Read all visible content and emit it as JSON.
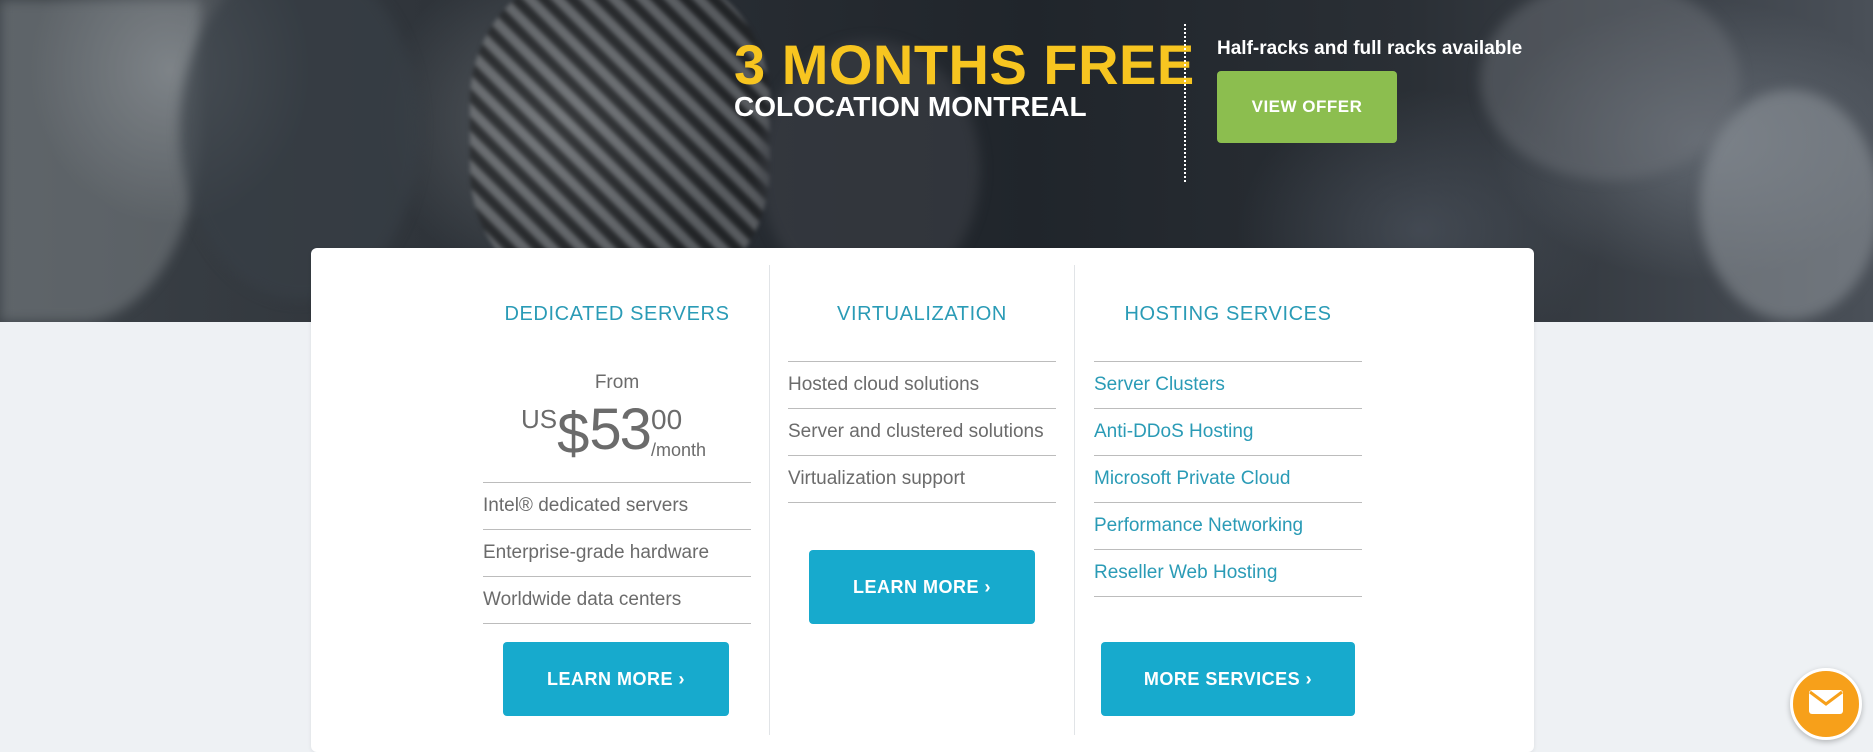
{
  "promo": {
    "headline": "3 MONTHS FREE",
    "subheadline": "COLOCATION MONTREAL",
    "offer_text": "Half-racks and full racks available",
    "offer_button": "VIEW OFFER"
  },
  "columns": {
    "dedicated": {
      "title": "DEDICATED SERVERS",
      "price_from": "From",
      "price_currency": "US",
      "price_symbol": "$",
      "price_amount": "53",
      "price_cents": "00",
      "price_period": "/month",
      "items": [
        "Intel® dedicated servers",
        "Enterprise-grade hardware",
        "Worldwide data centers"
      ],
      "button": "LEARN MORE ›"
    },
    "virtualization": {
      "title": "VIRTUALIZATION",
      "items": [
        "Hosted cloud solutions",
        "Server and clustered solutions",
        "Virtualization support"
      ],
      "button": "LEARN MORE ›"
    },
    "hosting": {
      "title": "HOSTING SERVICES",
      "items": [
        "Server Clusters",
        "Anti-DDoS Hosting",
        "Microsoft Private Cloud",
        "Performance Networking",
        "Reseller Web Hosting"
      ],
      "button": "MORE SERVICES ›"
    }
  },
  "colors": {
    "headline_yellow": "#f7c520",
    "offer_green": "#8cbe4f",
    "accent_blue": "#17aacd",
    "title_blue": "#2a9bb6",
    "chat_orange": "#f7a01a"
  },
  "icons": {
    "chat": "envelope-icon"
  }
}
